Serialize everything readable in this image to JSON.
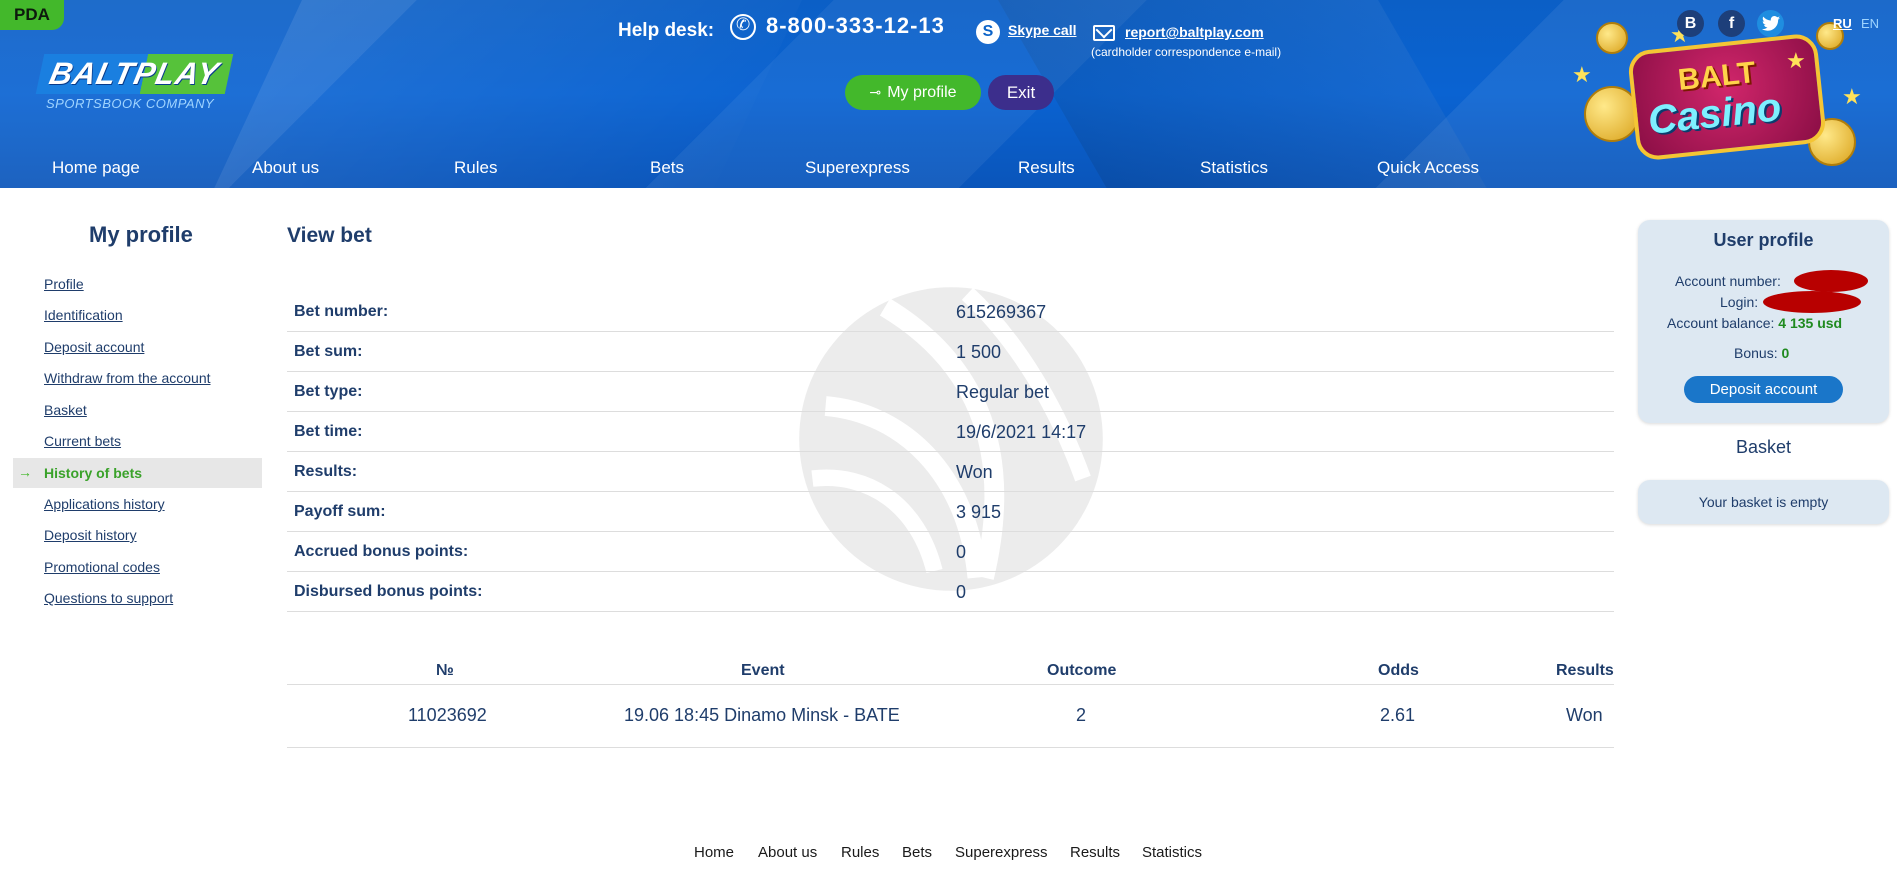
{
  "badge": "PDA",
  "logo": {
    "main": "BALTPLAY",
    "sub": "SPORTSBOOK COMPANY"
  },
  "contacts": {
    "helpdesk_label": "Help desk:",
    "phone": "8-800-333-12-13",
    "skype": "Skype call",
    "email": "report@baltplay.com",
    "email_note": "(cardholder correspondence e-mail)"
  },
  "header_buttons": {
    "profile": "My profile",
    "exit": "Exit"
  },
  "social": {
    "vk": "B",
    "fb": "f",
    "tw": "🐦"
  },
  "languages": [
    "RU",
    "EN"
  ],
  "casino": {
    "top": "BALT",
    "bottom": "Casino"
  },
  "nav": [
    "Home page",
    "About us",
    "Rules",
    "Bets",
    "Superexpress",
    "Results",
    "Statistics",
    "Quick Access"
  ],
  "sidebar": {
    "title": "My profile",
    "items": [
      "Profile",
      "Identification",
      "Deposit account",
      "Withdraw from the account",
      "Basket",
      "Current bets",
      "History of bets",
      "Applications history",
      "Deposit history",
      "Promotional codes",
      "Questions to support"
    ],
    "active": "History of bets"
  },
  "main": {
    "title": "View bet",
    "details": [
      {
        "label": "Bet number:",
        "value": "615269367"
      },
      {
        "label": "Bet sum:",
        "value": "1 500"
      },
      {
        "label": "Bet type:",
        "value": "Regular bet"
      },
      {
        "label": "Bet time:",
        "value": "19/6/2021 14:17"
      },
      {
        "label": "Results:",
        "value": "Won"
      },
      {
        "label": "Payoff sum:",
        "value": "3 915"
      },
      {
        "label": "Accrued bonus points:",
        "value": "0"
      },
      {
        "label": "Disbursed bonus points:",
        "value": "0"
      }
    ],
    "events_table": {
      "headers": [
        "№",
        "Event",
        "Outcome",
        "Odds",
        "Results"
      ],
      "rows": [
        [
          "11023692",
          "19.06 18:45 Dinamo Minsk - BATE",
          "2",
          "2.61",
          "Won"
        ]
      ]
    }
  },
  "user_profile": {
    "title": "User profile",
    "account_number_label": "Account number:",
    "login_label": "Login:",
    "balance_label": "Account balance:",
    "balance_value": "4 135 usd",
    "bonus_label": "Bonus:",
    "bonus_value": "0",
    "deposit_button": "Deposit account"
  },
  "basket": {
    "title": "Basket",
    "empty_text": "Your basket is empty"
  },
  "footer": [
    "Home",
    "About us",
    "Rules",
    "Bets",
    "Superexpress",
    "Results",
    "Statistics"
  ]
}
